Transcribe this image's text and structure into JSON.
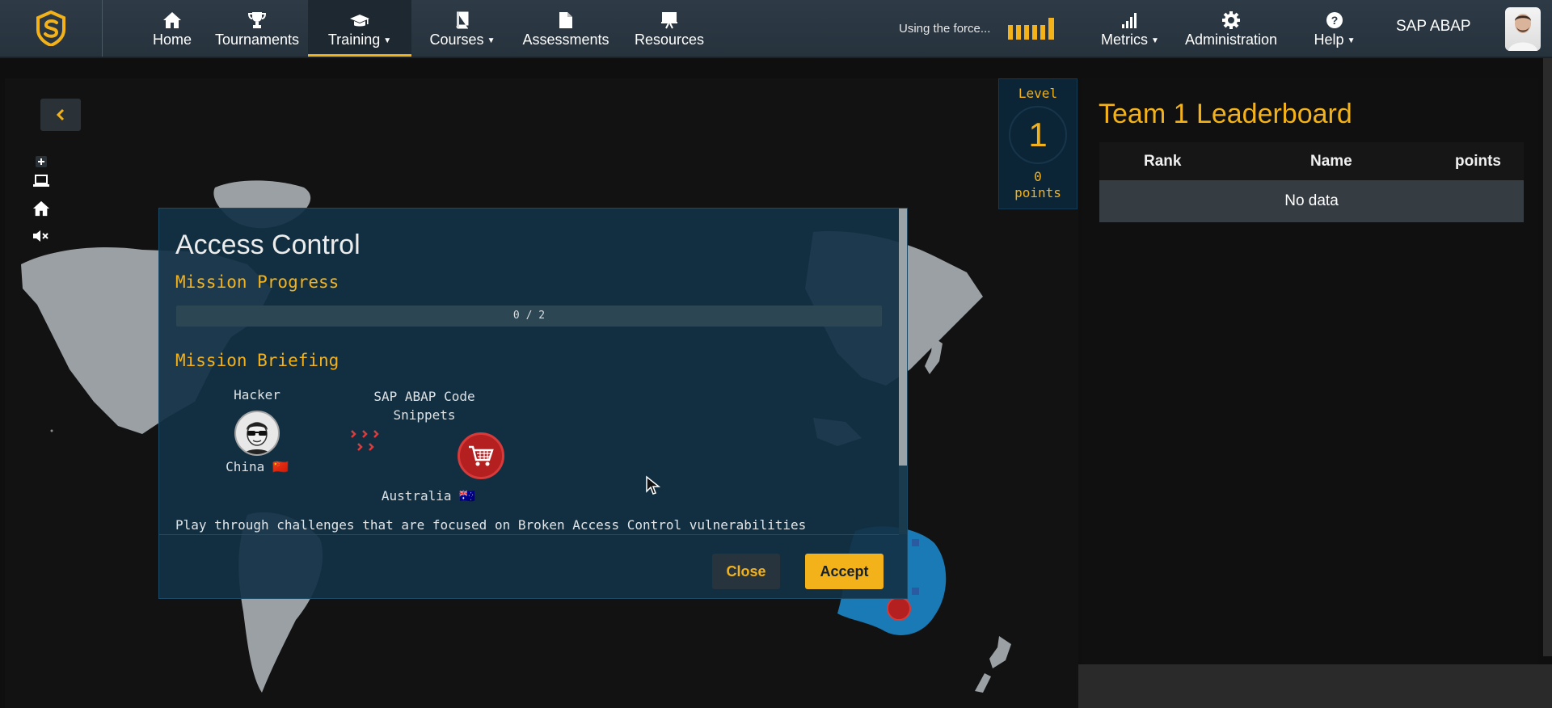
{
  "colors": {
    "accent": "#f3b21a",
    "navbar": "#2e3b47",
    "modal": "#123246",
    "danger": "#b41f1f"
  },
  "nav": {
    "items": [
      {
        "label": "Home",
        "icon": "home-icon"
      },
      {
        "label": "Tournaments",
        "icon": "trophy-icon"
      },
      {
        "label": "Training",
        "icon": "graduation-cap-icon",
        "active": true,
        "has_dropdown": true
      },
      {
        "label": "Courses",
        "icon": "book-icon",
        "has_dropdown": true
      },
      {
        "label": "Assessments",
        "icon": "document-icon"
      },
      {
        "label": "Resources",
        "icon": "presentation-icon"
      }
    ],
    "force_label": "Using the force...",
    "right_items": [
      {
        "label": "Metrics",
        "icon": "bar-chart-icon",
        "has_dropdown": true
      },
      {
        "label": "Administration",
        "icon": "gear-icon"
      },
      {
        "label": "Help",
        "icon": "help-circle-icon",
        "has_dropdown": true
      }
    ],
    "language": "SAP ABAP"
  },
  "level": {
    "label": "Level",
    "value": "1",
    "points_value": "0",
    "points_label": "points"
  },
  "leaderboard": {
    "title": "Team 1 Leaderboard",
    "columns": [
      "Rank",
      "Name",
      "points"
    ],
    "empty_text": "No data"
  },
  "modal": {
    "title": "Access Control",
    "progress_heading": "Mission Progress",
    "progress_text": "0 / 2",
    "progress_fraction": 0,
    "briefing_heading": "Mission Briefing",
    "attacker": {
      "name": "Hacker",
      "location": "China",
      "flag": "🇨🇳"
    },
    "target": {
      "name_line1": "SAP ABAP Code",
      "name_line2": "Snippets",
      "location": "Australia",
      "flag": "🇦🇺"
    },
    "description": "Play through challenges that are focused on Broken Access Control vulnerabilities",
    "close_label": "Close",
    "accept_label": "Accept"
  }
}
